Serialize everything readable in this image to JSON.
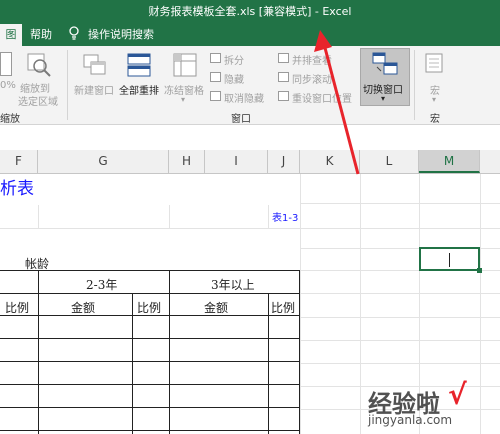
{
  "window": {
    "title": "财务报表模板全套.xls [兼容模式] - Excel"
  },
  "tabs": {
    "active_partial": "图",
    "help": "帮助",
    "tell_me": "操作说明搜索"
  },
  "ribbon": {
    "zoom_group": {
      "zoom_100_partial": "0%",
      "zoom_to_selection_line1": "缩放到",
      "zoom_to_selection_line2": "选定区域",
      "label_partial": "缩放"
    },
    "window_group": {
      "new_window": "新建窗口",
      "arrange_all": "全部重排",
      "freeze_panes": "冻结窗格",
      "split": "拆分",
      "hide": "隐藏",
      "unhide": "取消隐藏",
      "view_side_by_side": "并排查看",
      "sync_scroll": "同步滚动",
      "reset_position": "重设窗口位置",
      "switch_windows": "切换窗口",
      "label": "窗口"
    },
    "macro_group": {
      "macros": "宏",
      "label": "宏"
    }
  },
  "columns": [
    "F",
    "G",
    "H",
    "I",
    "J",
    "K",
    "L",
    "M"
  ],
  "selected_column": "M",
  "sheet": {
    "title_partial": "析表",
    "table_ref": "表1-3",
    "aging_header": "帐龄",
    "period_2_3": "2-3年",
    "period_3plus": "3年以上",
    "col_ratio": "比例",
    "col_amount": "金额"
  },
  "watermark": {
    "line1": "经验啦",
    "check": "√",
    "line2": "jingyanla.com"
  },
  "colors": {
    "excel_green": "#217346",
    "annotation_red": "#e8242b",
    "title_blue": "#1a1aff"
  }
}
